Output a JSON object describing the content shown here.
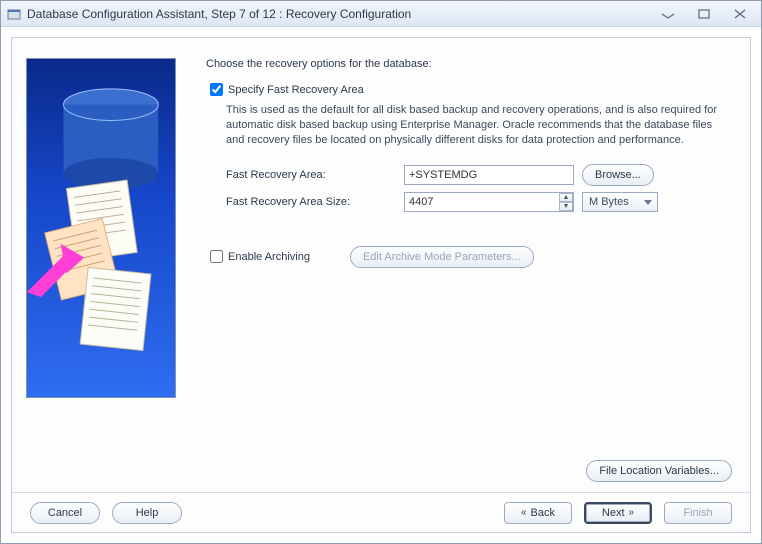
{
  "window": {
    "title": "Database Configuration Assistant, Step 7 of 12 : Recovery Configuration"
  },
  "content": {
    "heading": "Choose the recovery options for the database:",
    "specify_checkbox_label": "Specify Fast Recovery Area",
    "specify_checkbox_checked": true,
    "description": "This is used as the default for all disk based backup and recovery operations, and is also required for automatic disk based backup using Enterprise Manager. Oracle recommends that the database files and recovery files be located on physically different disks for data protection and performance.",
    "fra_label": "Fast Recovery Area:",
    "fra_value": "+SYSTEMDG",
    "browse_label": "Browse...",
    "fra_size_label": "Fast Recovery Area Size:",
    "fra_size_value": "4407",
    "fra_size_unit": "M Bytes",
    "archiving_checkbox_label": "Enable Archiving",
    "archiving_checkbox_checked": false,
    "edit_archive_label": "Edit Archive Mode Parameters...",
    "file_location_label": "File Location Variables..."
  },
  "buttons": {
    "cancel": "Cancel",
    "help": "Help",
    "back": "Back",
    "next": "Next",
    "finish": "Finish"
  }
}
